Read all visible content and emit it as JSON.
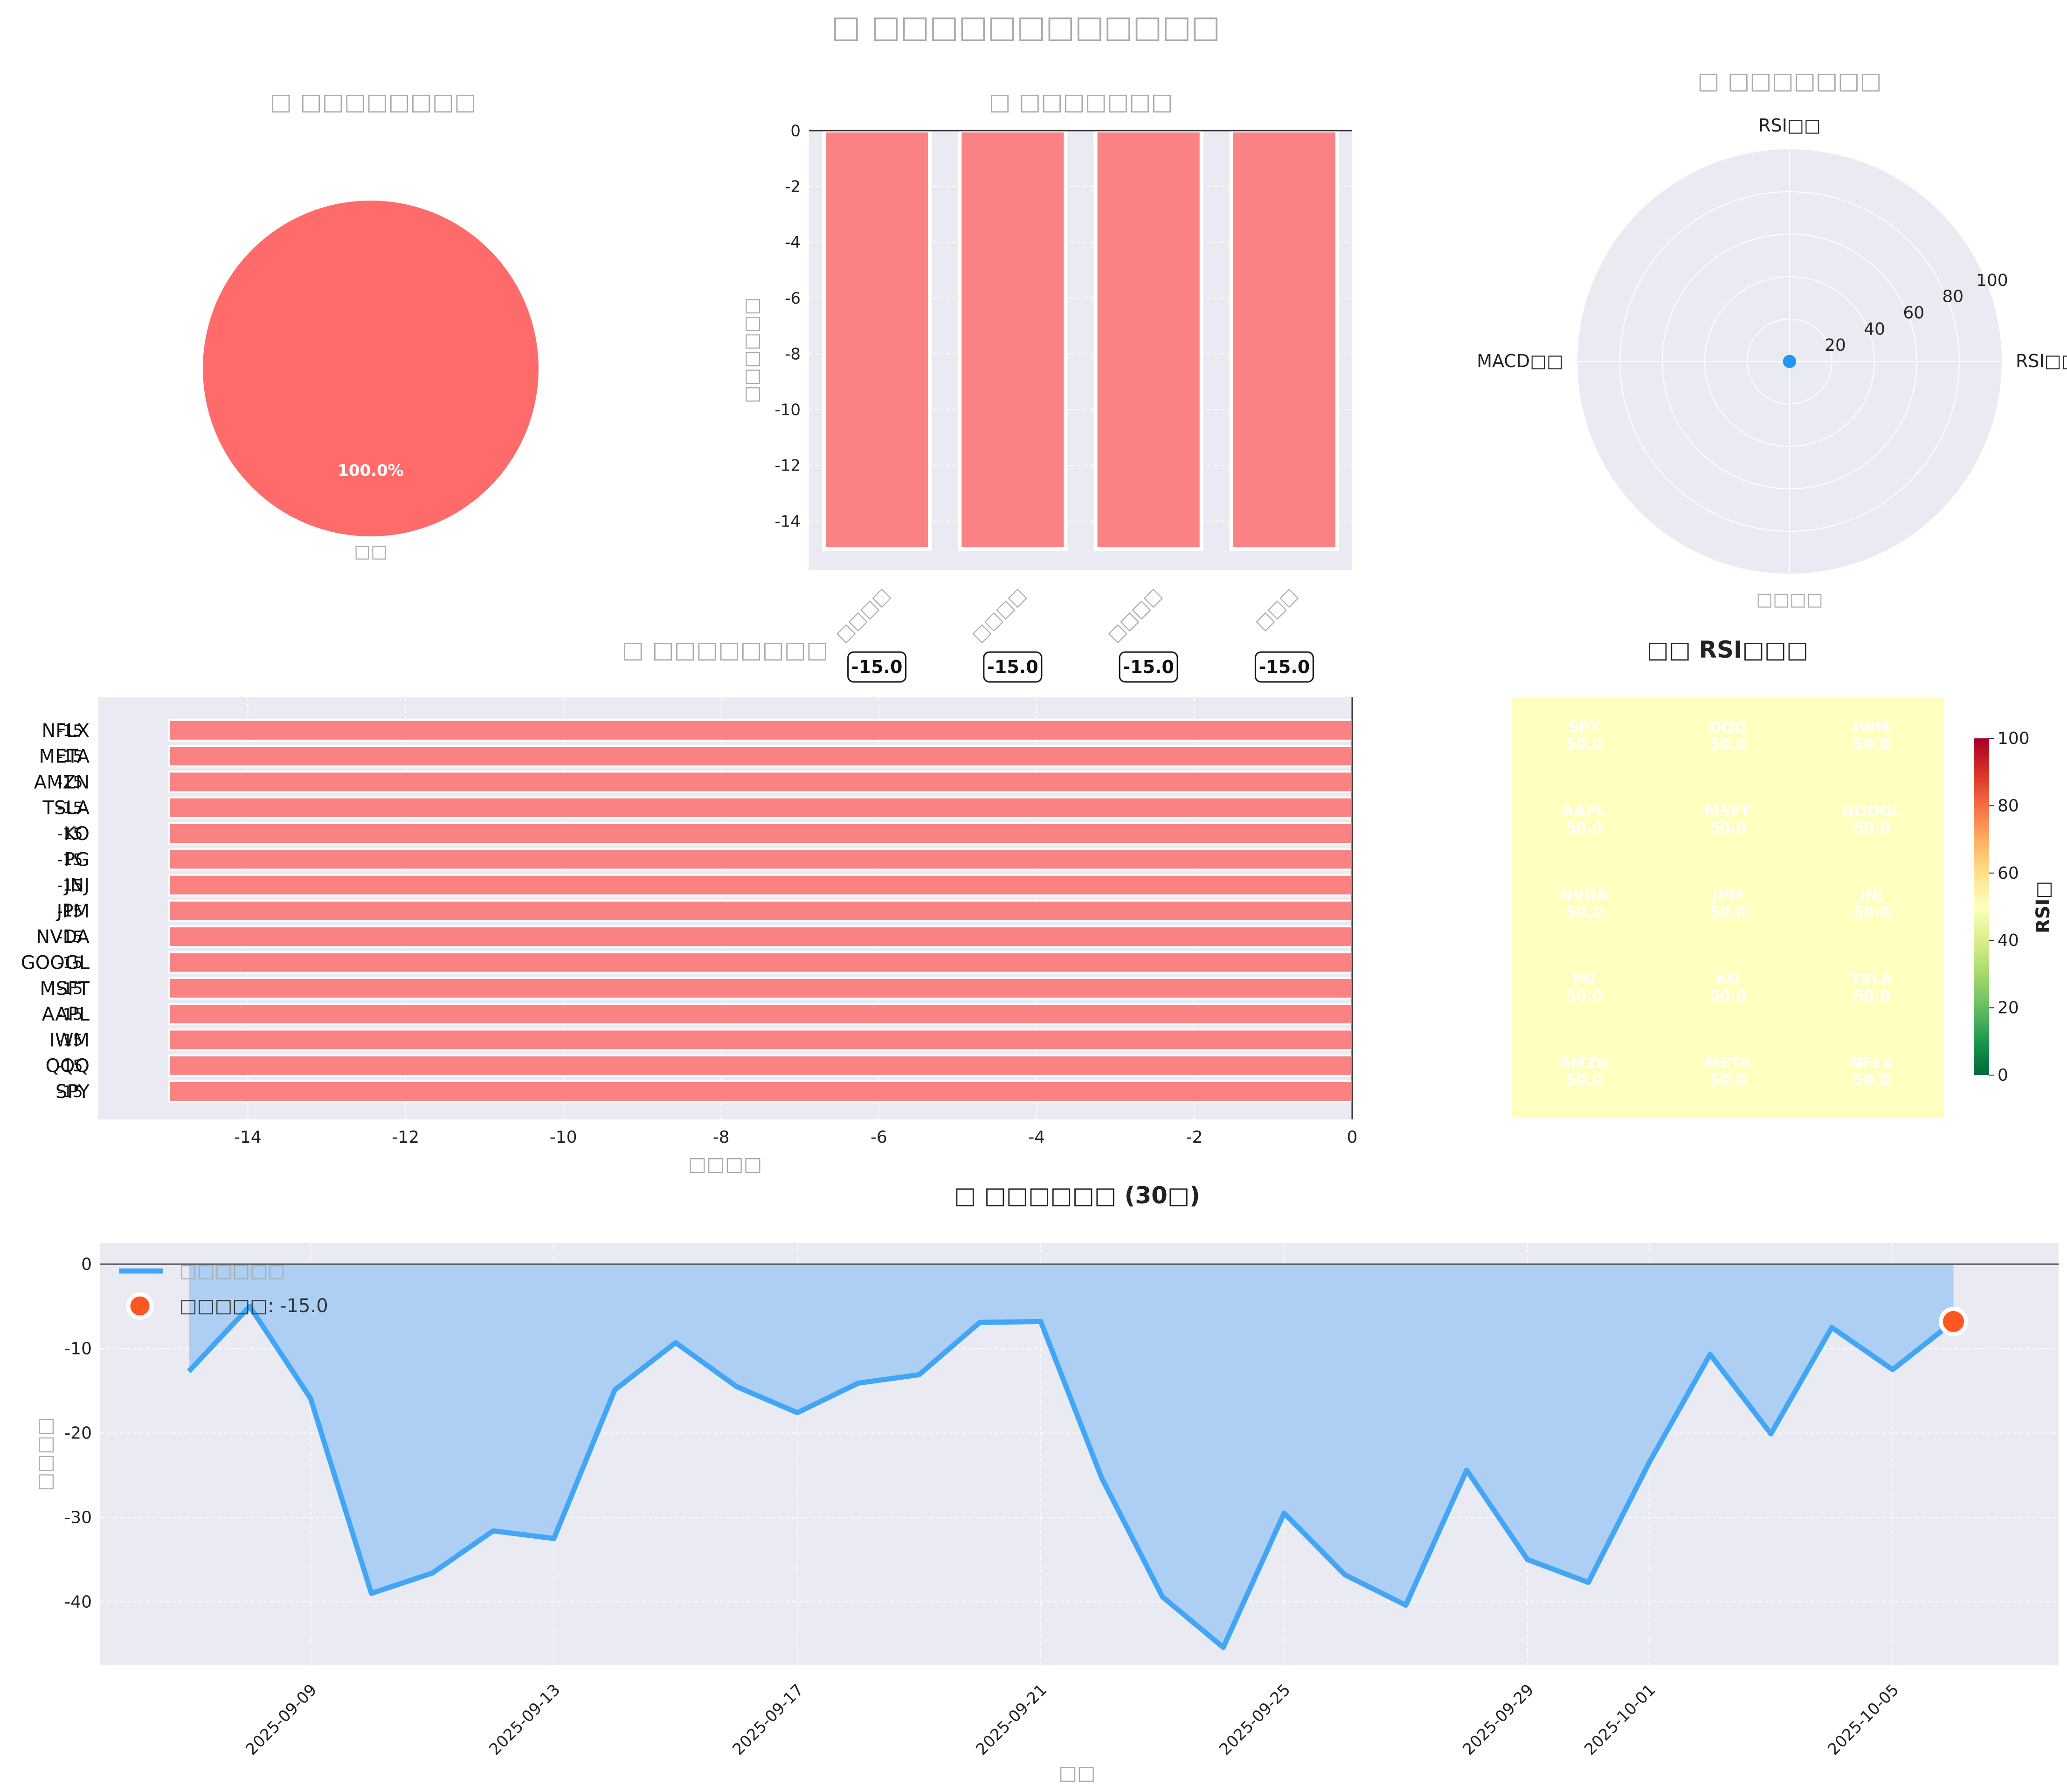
{
  "title": "□ □□□□□□□□□□□□",
  "colors": {
    "bar_red": "#fa8282",
    "pie_red": "#ff6b6b",
    "line_blue": "#42a5f5",
    "fill_blue": "#a9cdf2",
    "marker_orange": "#ff5722",
    "plot_bg": "#eaeaf2",
    "muted_text": "#aaaaaa",
    "heatmap_cell": "#ffffbf",
    "radar_point": "#2196f3"
  },
  "chart_data": [
    {
      "type": "pie",
      "title": "□ □□□□□□□□",
      "slices": [
        {
          "label": "□□",
          "value": 100.0,
          "pct_label": "100.0%"
        }
      ]
    },
    {
      "type": "bar",
      "title": "□ □□□□□□□",
      "ylabel": "□□□□□□",
      "categories": [
        "□□□□",
        "□□□□",
        "□□□□",
        "□□□"
      ],
      "values": [
        -15.0,
        -15.0,
        -15.0,
        -15.0
      ],
      "value_labels": [
        "-15.0",
        "-15.0",
        "-15.0",
        "-15.0"
      ],
      "ylim": [
        -15.75,
        0
      ],
      "yticks": [
        "0",
        "-2",
        "-4",
        "-6",
        "-8",
        "-10",
        "-12",
        "-14"
      ]
    },
    {
      "type": "radar",
      "title": "□ □□□□□□□",
      "axes": [
        "RSI□□",
        "MACD□□",
        "□□□□",
        "RSI□□"
      ],
      "rticks": [
        "20",
        "40",
        "60",
        "80",
        "100"
      ],
      "rlim": [
        0,
        100
      ],
      "values": [
        0,
        0,
        0,
        0
      ]
    },
    {
      "type": "barh",
      "title": "□ □□□□□□□□",
      "xlabel": "□□□□",
      "categories": [
        "SPY",
        "QQQ",
        "IWM",
        "AAPL",
        "MSFT",
        "GOOGL",
        "NVDA",
        "JPM",
        "JNJ",
        "PG",
        "KO",
        "TSLA",
        "AMZN",
        "META",
        "NFLX"
      ],
      "values": [
        -15,
        -15,
        -15,
        -15,
        -15,
        -15,
        -15,
        -15,
        -15,
        -15,
        -15,
        -15,
        -15,
        -15,
        -15
      ],
      "value_labels": [
        "-15",
        "-15",
        "-15",
        "-15",
        "-15",
        "-15",
        "-15",
        "-15",
        "-15",
        "-15",
        "-15",
        "-15",
        "-15",
        "-15",
        "-15"
      ],
      "xlim": [
        -15.9,
        0
      ],
      "xticks": [
        "-14",
        "-12",
        "-10",
        "-8",
        "-6",
        "-4",
        "-2",
        "0"
      ]
    },
    {
      "type": "heatmap",
      "title": "□□ RSI□□□",
      "colorbar_label": "RSI□",
      "colorbar_ticks": [
        "0",
        "20",
        "40",
        "60",
        "80",
        "100"
      ],
      "vmin": 0,
      "vmax": 100,
      "rows": [
        [
          {
            "label": "SPY",
            "value": 50.0
          },
          {
            "label": "QQQ",
            "value": 50.0
          },
          {
            "label": "IWM",
            "value": 50.0
          }
        ],
        [
          {
            "label": "AAPL",
            "value": 50.0
          },
          {
            "label": "MSFT",
            "value": 50.0
          },
          {
            "label": "GOOGL",
            "value": 50.0
          }
        ],
        [
          {
            "label": "NVDA",
            "value": 50.0
          },
          {
            "label": "JPM",
            "value": 50.0
          },
          {
            "label": "JNJ",
            "value": 50.0
          }
        ],
        [
          {
            "label": "PG",
            "value": 50.0
          },
          {
            "label": "KO",
            "value": 50.0
          },
          {
            "label": "TSLA",
            "value": 50.0
          }
        ],
        [
          {
            "label": "AMZN",
            "value": 50.0
          },
          {
            "label": "META",
            "value": 50.0
          },
          {
            "label": "NFLX",
            "value": 50.0
          }
        ]
      ],
      "value_format": "50.0"
    },
    {
      "type": "area",
      "title": "□ □□□□□□ (30□)",
      "xlabel": "□□",
      "ylabel": "□□□□",
      "ylim": [
        -47.5,
        2.5
      ],
      "yticks": [
        "0",
        "-10",
        "-20",
        "-30",
        "-40"
      ],
      "xticks": [
        "2025-09-09",
        "2025-09-13",
        "2025-09-17",
        "2025-09-21",
        "2025-09-25",
        "2025-09-29",
        "2025-10-01",
        "2025-10-05"
      ],
      "x": [
        "2025-09-07",
        "2025-09-08",
        "2025-09-09",
        "2025-09-10",
        "2025-09-11",
        "2025-09-12",
        "2025-09-13",
        "2025-09-14",
        "2025-09-15",
        "2025-09-16",
        "2025-09-17",
        "2025-09-18",
        "2025-09-19",
        "2025-09-20",
        "2025-09-21",
        "2025-09-22",
        "2025-09-23",
        "2025-09-24",
        "2025-09-25",
        "2025-09-26",
        "2025-09-27",
        "2025-09-28",
        "2025-09-29",
        "2025-09-30",
        "2025-10-01",
        "2025-10-02",
        "2025-10-03",
        "2025-10-04",
        "2025-10-05",
        "2025-10-06"
      ],
      "series": [
        {
          "name": "□□□□□□",
          "values": [
            -12.7,
            -5.0,
            -15.9,
            -39.0,
            -36.6,
            -31.6,
            -32.5,
            -14.9,
            -9.3,
            -14.5,
            -17.6,
            -14.1,
            -13.1,
            -6.9,
            -6.8,
            -25.3,
            -39.4,
            -45.4,
            -29.5,
            -36.8,
            -40.4,
            -24.4,
            -35.0,
            -37.7,
            -23.5,
            -10.7,
            -20.1,
            -7.5,
            -12.5,
            -6.8
          ]
        }
      ],
      "current_point": {
        "x": "2025-10-06",
        "value": -6.8
      },
      "current_label": "□□□□□: -15.0"
    }
  ]
}
